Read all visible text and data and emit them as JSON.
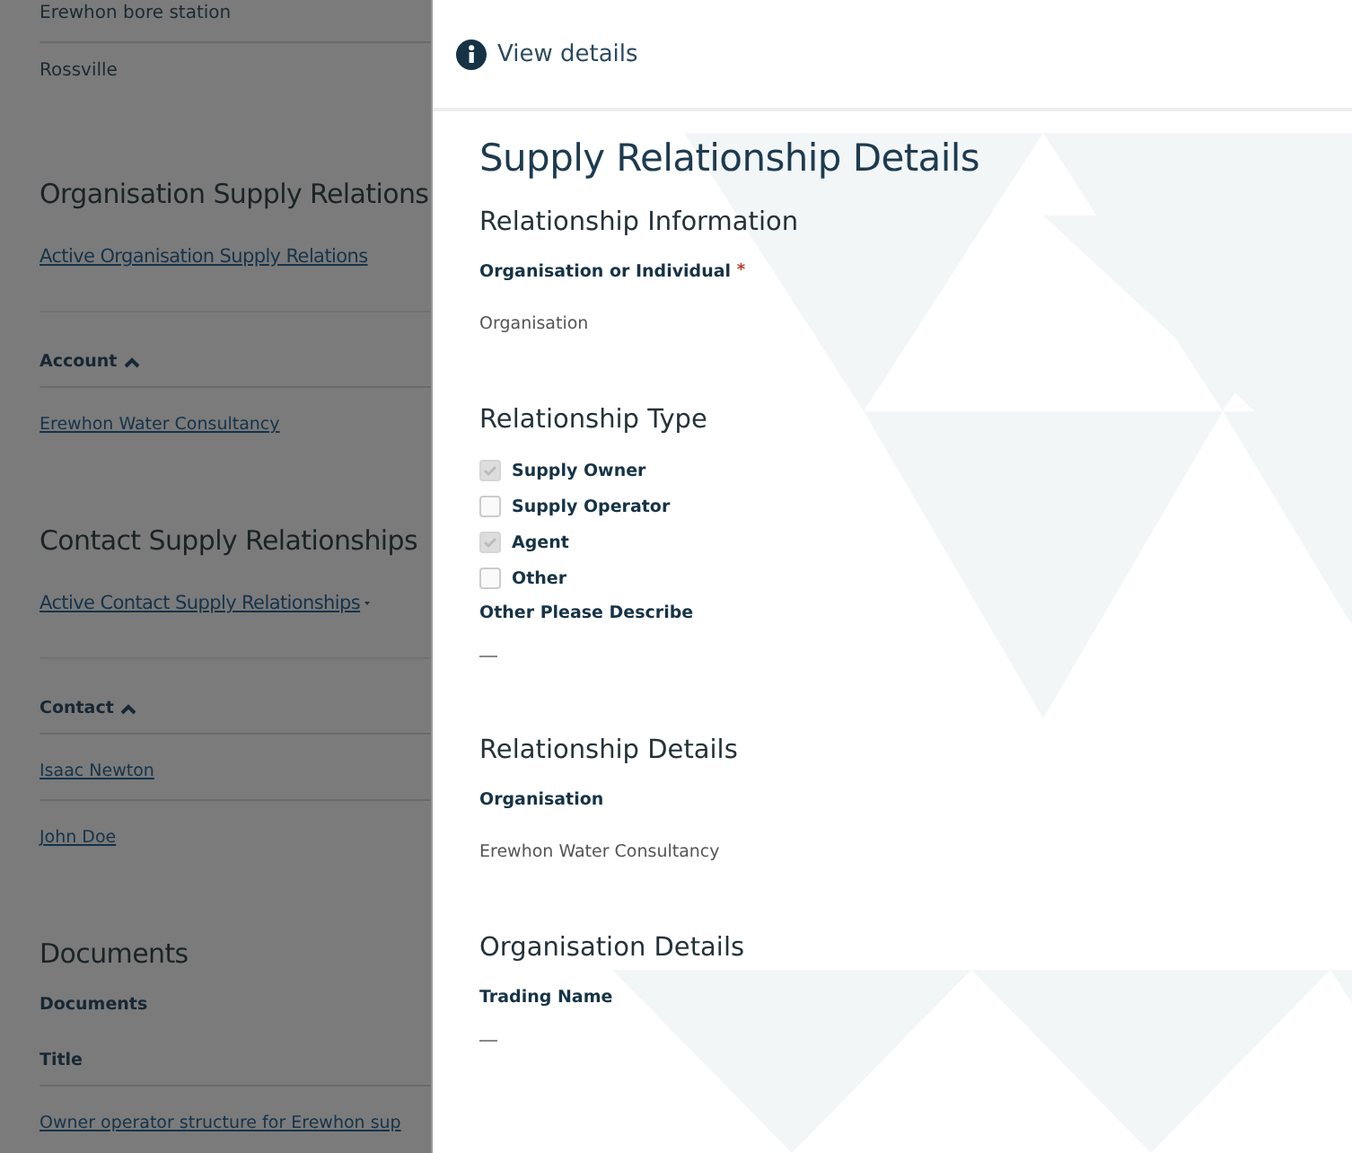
{
  "background_page": [
    {
      "kind": "text",
      "text": "Erewhon bore station",
      "divider": true
    },
    {
      "kind": "text",
      "text": "Rossville",
      "divider": false
    },
    {
      "kind": "heading",
      "text": "Organisation Supply Relations"
    },
    {
      "kind": "dropdown_link",
      "text": "Active Organisation Supply Relations",
      "caret": false
    },
    {
      "kind": "column_header",
      "text": "Account"
    },
    {
      "kind": "link",
      "text": "Erewhon Water Consultancy",
      "divider": false
    },
    {
      "kind": "heading",
      "text": "Contact Supply Relationships"
    },
    {
      "kind": "dropdown_link",
      "text": "Active Contact Supply Relationships",
      "caret": true
    },
    {
      "kind": "column_header",
      "text": "Contact"
    },
    {
      "kind": "link",
      "text": "Isaac Newton",
      "divider": true
    },
    {
      "kind": "link",
      "text": "John Doe",
      "divider": false
    },
    {
      "kind": "heading",
      "text": "Documents"
    },
    {
      "kind": "label",
      "text": "Documents"
    },
    {
      "kind": "column_header_plain",
      "text": "Title"
    },
    {
      "kind": "link",
      "text": "Owner operator structure for Erewhon sup",
      "divider": false
    }
  ],
  "panel": {
    "header": "View details",
    "title": "Supply Relationship Details",
    "items": [
      {
        "kind": "section",
        "text": "Relationship Information"
      },
      {
        "kind": "label",
        "text": "Organisation or Individual",
        "required_mark": "*"
      },
      {
        "kind": "value",
        "text": "Organisation"
      },
      {
        "kind": "section",
        "text": "Relationship Type"
      },
      {
        "kind": "checkbox",
        "text": "Supply Owner",
        "checked": true
      },
      {
        "kind": "checkbox",
        "text": "Supply Operator",
        "checked": false
      },
      {
        "kind": "checkbox",
        "text": "Agent",
        "checked": true
      },
      {
        "kind": "checkbox",
        "text": "Other",
        "checked": false
      },
      {
        "kind": "label",
        "text": "Other Please Describe"
      },
      {
        "kind": "empty"
      },
      {
        "kind": "section",
        "text": "Relationship Details"
      },
      {
        "kind": "label",
        "text": "Organisation"
      },
      {
        "kind": "value",
        "text": "Erewhon Water Consultancy"
      },
      {
        "kind": "section",
        "text": "Organisation Details"
      },
      {
        "kind": "label",
        "text": "Trading Name"
      },
      {
        "kind": "empty"
      }
    ]
  }
}
